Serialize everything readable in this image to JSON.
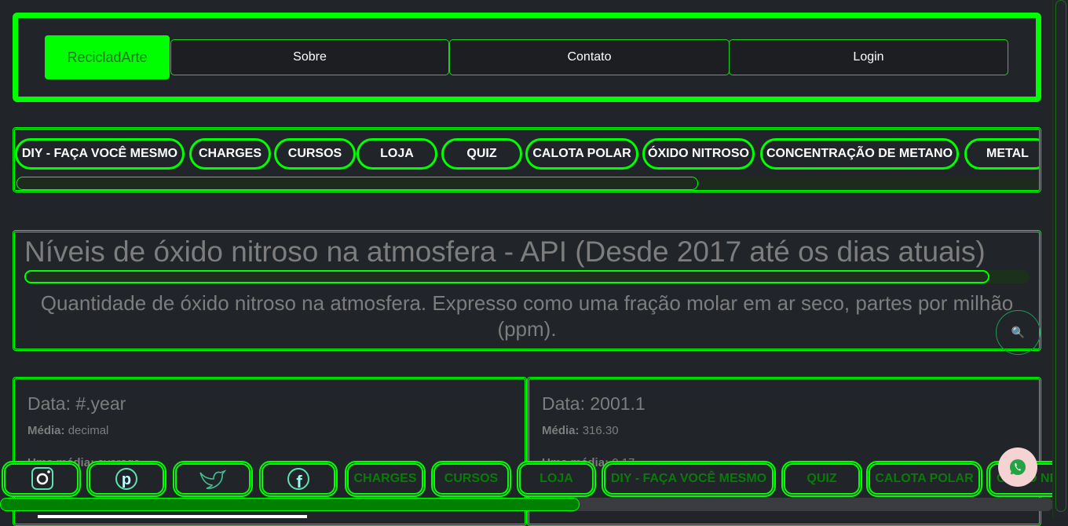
{
  "header": {
    "brand": "RecicladArte",
    "links": [
      "Sobre",
      "Contato",
      "Login"
    ]
  },
  "categories": [
    "DIY - FAÇA VOCÊ MESMO",
    "CHARGES",
    "CURSOS",
    "LOJA",
    "QUIZ",
    "CALOTA POLAR",
    "ÓXIDO NITROSO",
    "CONCENTRAÇÃO DE METANO",
    "METAL"
  ],
  "main": {
    "title": "Níveis de óxido nitroso na atmosfera - API (Desde 2017 até os dias atuais)",
    "title_progress_percent": 96,
    "subtitle": "Quantidade de óxido nitroso na atmosfera. Expresso como uma fração molar em ar seco, partes por milhão (ppm).",
    "search_icon": "magnifier-icon"
  },
  "cards": [
    {
      "data": "Data: #.year",
      "media_label": "Média:",
      "media": "decimal",
      "uma_label": "Uma média:",
      "uma": "average"
    },
    {
      "data": "Data: 2001.1",
      "media_label": "Média:",
      "media": "316.30",
      "uma_label": "Uma média:",
      "uma": "0.17"
    }
  ],
  "bottom_nav": {
    "social": [
      "instagram-icon",
      "pinterest-icon",
      "twitter-icon",
      "facebook-icon"
    ],
    "links": [
      "CHARGES",
      "CURSOS",
      "LOJA",
      "DIY - FAÇA VOCÊ MESMO",
      "QUIZ",
      "CALOTA POLAR",
      "ÓXIDO NITROSO"
    ],
    "scroll_percent": 55
  },
  "colors": {
    "accent": "#00ff00",
    "background": "#212429",
    "dark_green": "#008000"
  }
}
